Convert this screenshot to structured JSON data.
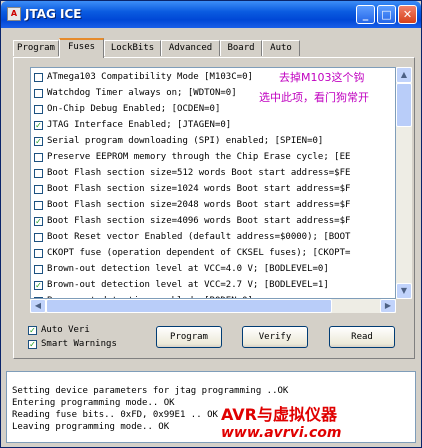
{
  "window": {
    "title": "JTAG ICE"
  },
  "titlebar_buttons": {
    "minimize": "_",
    "maximize": "□",
    "close": "✕"
  },
  "tabs": [
    {
      "label": "Program"
    },
    {
      "label": "Fuses"
    },
    {
      "label": "LockBits"
    },
    {
      "label": "Advanced"
    },
    {
      "label": "Board"
    },
    {
      "label": "Auto"
    }
  ],
  "active_tab": "Fuses",
  "fuses": [
    {
      "label": "ATmega103 Compatibility Mode [M103C=0]",
      "checked": false
    },
    {
      "label": "Watchdog Timer always on; [WDTON=0]",
      "checked": false
    },
    {
      "label": "On-Chip Debug Enabled; [OCDEN=0]",
      "checked": false
    },
    {
      "label": "JTAG Interface Enabled; [JTAGEN=0]",
      "checked": true
    },
    {
      "label": "Serial program downloading (SPI) enabled; [SPIEN=0]",
      "checked": true
    },
    {
      "label": "Preserve EEPROM memory through the Chip Erase cycle; [EE",
      "checked": false
    },
    {
      "label": "Boot Flash section size=512 words Boot start address=$FE",
      "checked": false
    },
    {
      "label": "Boot Flash section size=1024 words Boot start address=$F",
      "checked": false
    },
    {
      "label": "Boot Flash section size=2048 words Boot start address=$F",
      "checked": false
    },
    {
      "label": "Boot Flash section size=4096 words Boot start address=$F",
      "checked": true
    },
    {
      "label": "Boot Reset vector Enabled (default address=$0000); [BOOT",
      "checked": false
    },
    {
      "label": "CKOPT fuse (operation dependent of CKSEL fuses); [CKOPT=",
      "checked": false
    },
    {
      "label": "Brown-out detection level at VCC=4.0 V; [BODLEVEL=0]",
      "checked": false
    },
    {
      "label": "Brown-out detection level at VCC=2.7 V; [BODLEVEL=1]",
      "checked": true
    },
    {
      "label": "Brown-out detection enabled; [BODEN=0]",
      "checked": false
    }
  ],
  "annotations": {
    "line1": "去掉M103这个钩",
    "line2": "选中此项，看门狗常开"
  },
  "options": {
    "auto_verify": {
      "label": "Auto Veri",
      "checked": true
    },
    "smart_warnings": {
      "label": "Smart Warnings",
      "checked": true
    }
  },
  "buttons": {
    "program": "Program",
    "verify": "Verify",
    "read": "Read"
  },
  "log": [
    "Setting device parameters for jtag programming ..OK",
    "Entering programming mode.. OK",
    "Reading fuse bits.. 0xFD, 0x99E1 .. OK",
    "Leaving programming mode.. OK"
  ],
  "watermark": {
    "brand": "AVR与虚拟仪器",
    "url": "www.avrvi.com"
  },
  "scroll_arrows": {
    "up": "▲",
    "down": "▼",
    "left": "◀",
    "right": "▶"
  },
  "colors": {
    "title_bar": "#0a5be0",
    "accent_tab": "#e68b2c",
    "annotation": "#c000c0",
    "watermark": "#e00000"
  }
}
